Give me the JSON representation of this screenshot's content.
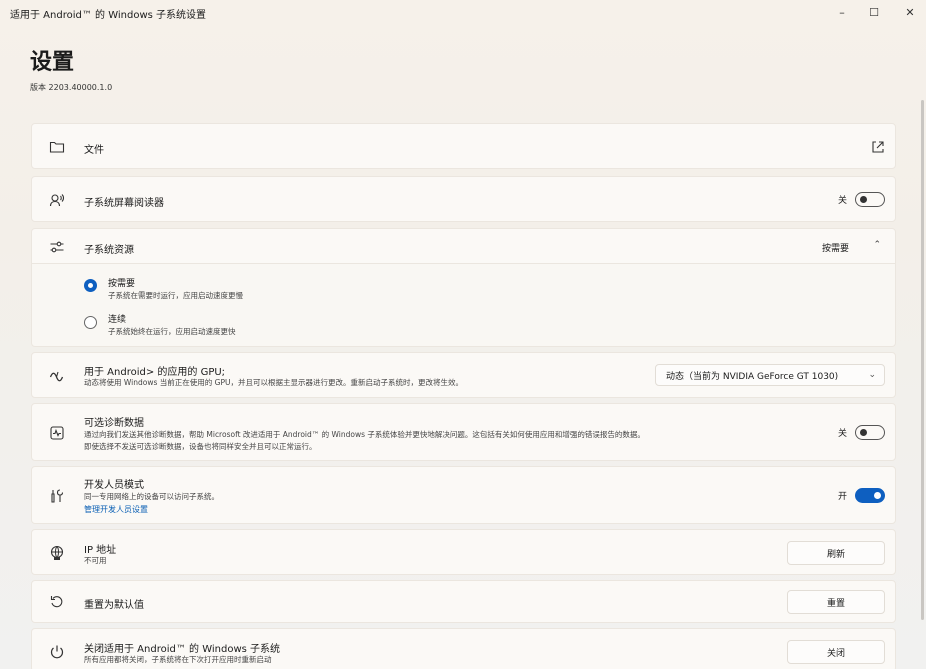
{
  "window": {
    "title": "适用于 Android™ 的 Windows 子系统设置",
    "minimize": "–",
    "maximize": "☐",
    "close": "✕"
  },
  "page": {
    "title": "设置",
    "version": "版本 2203.40000.1.0"
  },
  "files": {
    "label": "文件",
    "icon": "folder-icon",
    "action_icon": "open-external-icon"
  },
  "screen_reader": {
    "label": "子系统屏幕阅读器",
    "icon": "screen-reader-icon",
    "toggle_text": "关",
    "toggle_on": false
  },
  "resources": {
    "label": "子系统资源",
    "icon": "sliders-icon",
    "value": "按需要",
    "expanded": true,
    "options": [
      {
        "label": "按需要",
        "desc": "子系统在需要时运行，应用启动速度更慢",
        "checked": true
      },
      {
        "label": "连续",
        "desc": "子系统始终在运行，应用启动速度更快",
        "checked": false
      }
    ]
  },
  "gpu": {
    "label": "用于 Android> 的应用的 GPU;",
    "desc": "动态将使用 Windows 当前正在使用的 GPU，并且可以根据主显示器进行更改。重新启动子系统时，更改将生效。",
    "icon": "gpu-icon",
    "selected": "动态（当前为 NVIDIA GeForce GT 1030)"
  },
  "diagnostics": {
    "label": "可选诊断数据",
    "desc1": "通过向我们发送其他诊断数据，帮助 Microsoft 改进适用于 Android™ 的 Windows 子系统体验并更快地解决问题。这包括有关如何使用应用和增强的错误报告的数据。",
    "desc2": "即使选择不发送可选诊断数据，设备也将同样安全并且可以正常运行。",
    "icon": "activity-icon",
    "toggle_text": "关",
    "toggle_on": false
  },
  "developer": {
    "label": "开发人员模式",
    "desc": "同一专用网络上的设备可以访问子系统。",
    "link": "管理开发人员设置",
    "icon": "developer-tools-icon",
    "toggle_text": "开",
    "toggle_on": true
  },
  "ip": {
    "label": "IP 地址",
    "desc": "不可用",
    "icon": "network-icon",
    "button": "刷新"
  },
  "reset": {
    "label": "重置为默认值",
    "icon": "reset-icon",
    "button": "重置"
  },
  "shutdown": {
    "label": "关闭适用于 Android™ 的 Windows 子系统",
    "desc": "所有应用都将关闭，子系统将在下次打开应用时重新启动",
    "icon": "power-icon",
    "button": "关闭"
  },
  "colors": {
    "accent": "#0e5fc0",
    "link": "#0a5fb4"
  }
}
